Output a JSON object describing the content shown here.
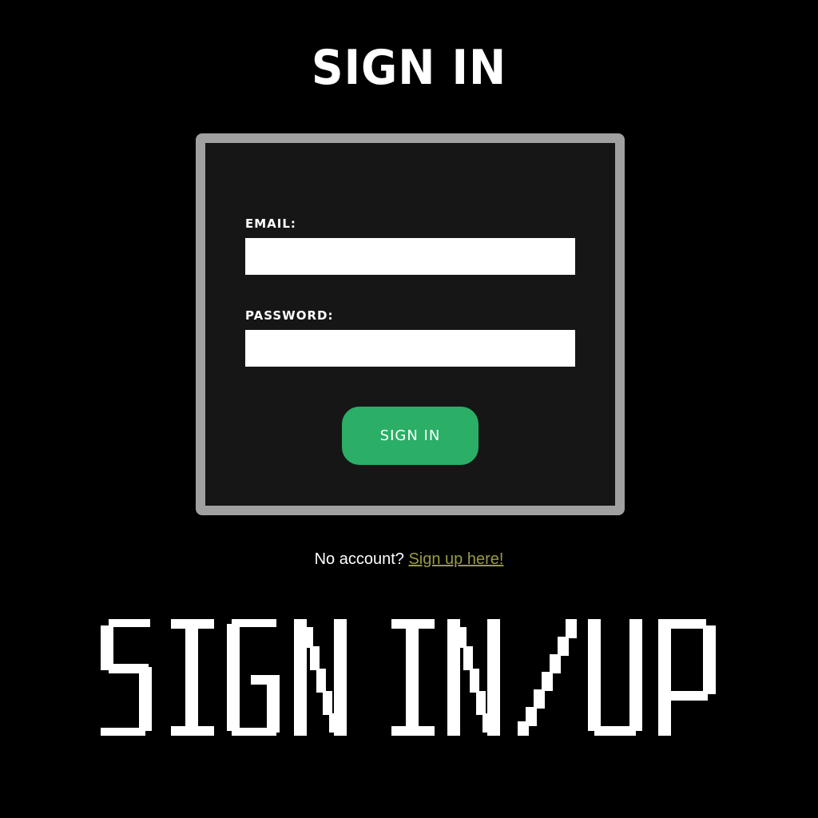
{
  "header": {
    "title": "SIGN IN"
  },
  "form": {
    "email_label": "EMAIL:",
    "email_value": "",
    "password_label": "PASSWORD:",
    "password_value": "",
    "submit_label": "SIGN IN"
  },
  "signup": {
    "prompt": "No account?",
    "link_label": "Sign up here!"
  },
  "banner": {
    "text": "SIGN IN/UP"
  },
  "colors": {
    "background": "#000000",
    "card_border": "#a0a0a0",
    "card_background": "#161616",
    "button": "#2bae66",
    "link": "#9a9a45"
  }
}
